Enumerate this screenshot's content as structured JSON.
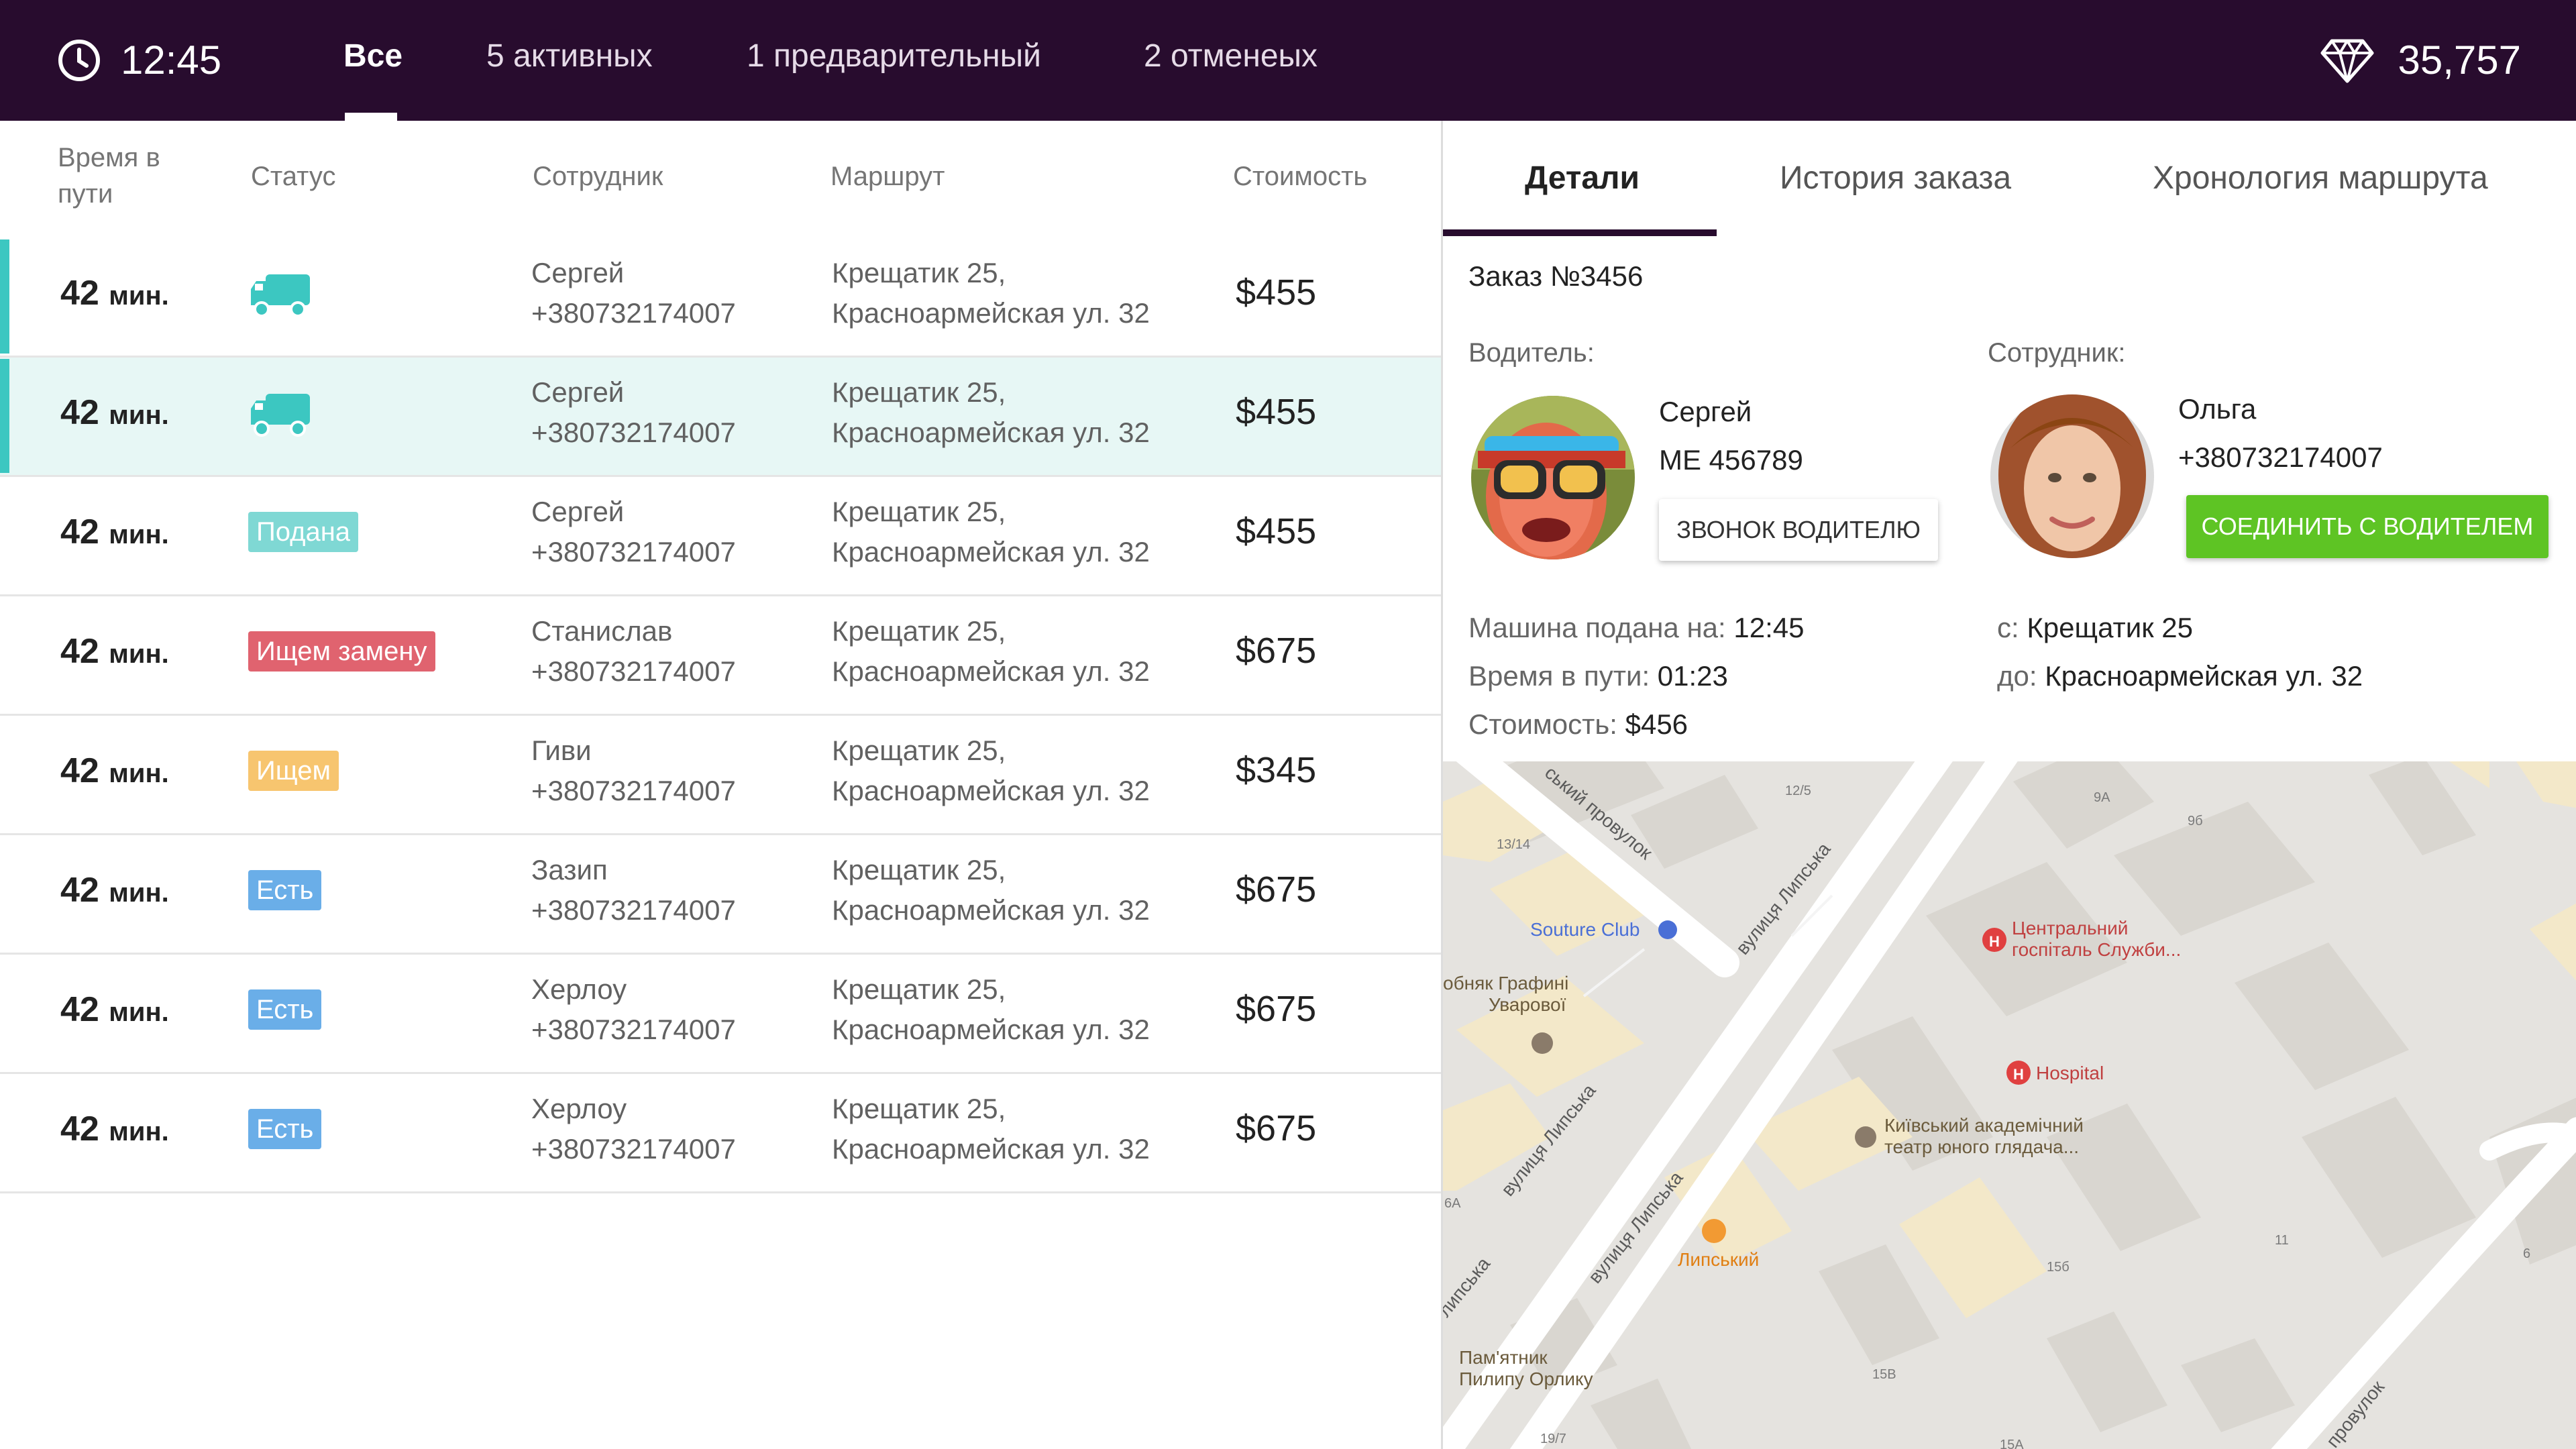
{
  "header": {
    "time": "12:45",
    "tabs": [
      {
        "label": "Все"
      },
      {
        "label": "5 активных"
      },
      {
        "label": "1 предварительный"
      },
      {
        "label": "2 отменеых"
      }
    ],
    "balance": "35,757"
  },
  "table": {
    "headers": {
      "time": "Время в пути",
      "status": "Статус",
      "staff": "Сотрудник",
      "route": "Маршрут",
      "price": "Стоимость"
    },
    "rows": [
      {
        "time": "42",
        "unit": "мин.",
        "status_type": "truck",
        "status": "",
        "staff_name": "Сергей",
        "staff_phone": "+380732174007",
        "from": "Крещатик 25,",
        "to": "Красноармейская ул. 32",
        "price": "$455"
      },
      {
        "time": "42",
        "unit": "мин.",
        "status_type": "truck",
        "status": "",
        "staff_name": "Сергей",
        "staff_phone": "+380732174007",
        "from": "Крещатик 25,",
        "to": "Красноармейская ул. 32",
        "price": "$455"
      },
      {
        "time": "42",
        "unit": "мин.",
        "status_type": "badge",
        "status": "Подана",
        "badge_color": "#7fd8d4",
        "staff_name": "Сергей",
        "staff_phone": "+380732174007",
        "from": "Крещатик 25,",
        "to": "Красноармейская ул. 32",
        "price": "$455"
      },
      {
        "time": "42",
        "unit": "мин.",
        "status_type": "badge",
        "status": "Ищем замену",
        "badge_color": "#e0636f",
        "staff_name": "Станислав",
        "staff_phone": "+380732174007",
        "from": "Крещатик 25,",
        "to": "Красноармейская ул. 32",
        "price": "$675"
      },
      {
        "time": "42",
        "unit": "мин.",
        "status_type": "badge",
        "status": "Ищем",
        "badge_color": "#f7c56f",
        "staff_name": "Гиви",
        "staff_phone": "+380732174007",
        "from": "Крещатик 25,",
        "to": "Красноармейская ул. 32",
        "price": "$345"
      },
      {
        "time": "42",
        "unit": "мин.",
        "status_type": "badge",
        "status": "Есть",
        "badge_color": "#6aaee8",
        "staff_name": "Зазип",
        "staff_phone": "+380732174007",
        "from": "Крещатик 25,",
        "to": "Красноармейская ул. 32",
        "price": "$675"
      },
      {
        "time": "42",
        "unit": "мин.",
        "status_type": "badge",
        "status": "Есть",
        "badge_color": "#6aaee8",
        "staff_name": "Херлоу",
        "staff_phone": "+380732174007",
        "from": "Крещатик 25,",
        "to": "Красноармейская ул. 32",
        "price": "$675"
      },
      {
        "time": "42",
        "unit": "мин.",
        "status_type": "badge",
        "status": "Есть",
        "badge_color": "#6aaee8",
        "staff_name": "Херлоу",
        "staff_phone": "+380732174007",
        "from": "Крещатик 25,",
        "to": "Красноармейская ул. 32",
        "price": "$675"
      }
    ]
  },
  "details": {
    "tabs": [
      {
        "label": "Детали"
      },
      {
        "label": "История заказа"
      },
      {
        "label": "Хронология маршрута"
      }
    ],
    "order_title": "Заказ №3456",
    "driver_label": "Водитель:",
    "driver_name": "Сергей",
    "driver_plate": "МЕ 456789",
    "call_driver_button": "ЗВОНОК ВОДИТЕЛЮ",
    "employee_label": "Сотрудник:",
    "employee_name": "Ольга",
    "employee_phone": "+380732174007",
    "connect_button": "СОЕДИНИТЬ С ВОДИТЕЛЕМ",
    "car_arrived_label": "Машина подана на:",
    "car_arrived_value": "12:45",
    "travel_time_label": "Время в пути:",
    "travel_time_value": "01:23",
    "cost_label": "Стоимость:",
    "cost_value": "$456",
    "from_label": "с:",
    "from_value": "Крещатик 25",
    "to_label": "до:",
    "to_value": "Красноармейская ул. 32"
  },
  "map": {
    "labels": {
      "souture": "Souture Club",
      "grafini_1": "обняк Графині",
      "grafini_2": "Уварової",
      "hospital_central_1": "Центральний",
      "hospital_central_2": "госпіталь Служби...",
      "hospital": "Hospital",
      "theatre_1": "Київський академічний",
      "theatre_2": "театр юного глядача...",
      "lypskyi": "Липський",
      "monument_1": "Пам'ятник",
      "monument_2": "Пилипу Орлику",
      "street_lypska_1": "вулиця Липська",
      "street_lypska_2": "вулиця Липська",
      "street_lypska_3": "вулиця Липська",
      "street_lypska_4": "липська",
      "provulok_1": "ський провулок",
      "provulok_2": "провулок",
      "n_12_5": "12/5",
      "n_13_14": "13/14",
      "n_9a": "9А",
      "n_9b": "9б",
      "n_11": "11",
      "n_15b": "15б",
      "n_15v": "15В",
      "n_6a": "6А",
      "n_6": "6",
      "n_19_7": "19/7",
      "n_15a": "15А"
    }
  },
  "colors": {
    "topbar": "#280c2e",
    "selected_row": "#e7f7f5",
    "marker": "#3cc7c1",
    "truck": "#3cc7c1",
    "green_button": "#5ec424"
  }
}
